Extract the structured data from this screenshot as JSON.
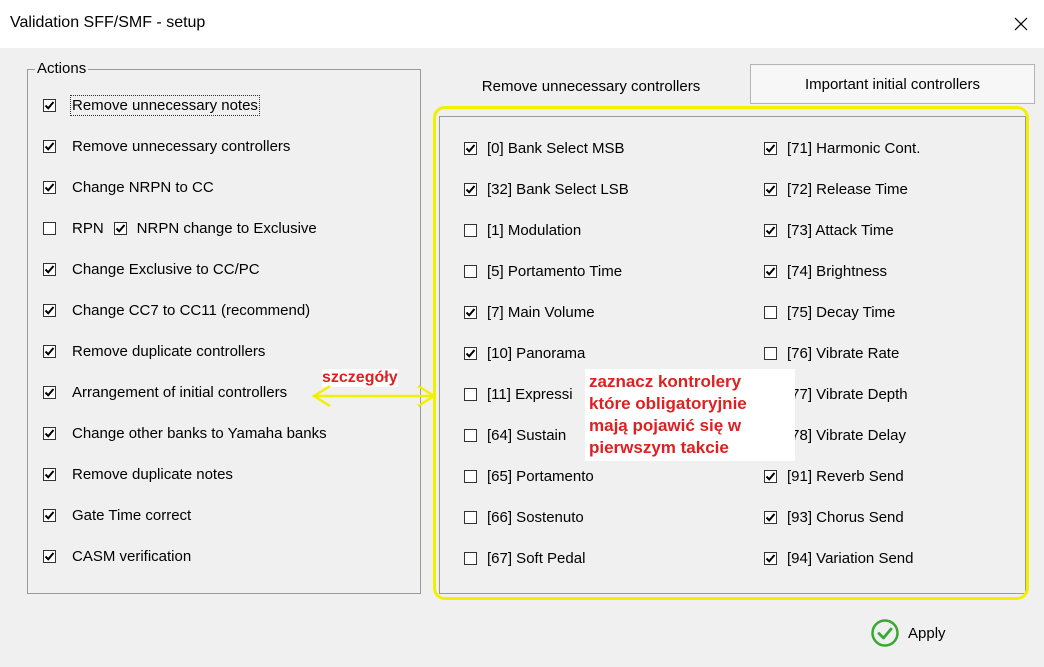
{
  "window": {
    "title": "Validation SFF/SMF - setup",
    "close_glyph": "×"
  },
  "actions": {
    "legend": "Actions",
    "items": [
      {
        "label": "Remove unnecessary notes",
        "checked": true
      },
      {
        "label": "Remove unnecessary controllers",
        "checked": true
      },
      {
        "label": "Change NRPN to CC",
        "checked": true
      },
      {
        "label": "RPN",
        "checked": false,
        "second_label": "NRPN  change to Exclusive",
        "second_checked": true
      },
      {
        "label": "Change Exclusive to CC/PC",
        "checked": true
      },
      {
        "label": "Change CC7 to CC11 (recommend)",
        "checked": true
      },
      {
        "label": "Remove duplicate controllers",
        "checked": true
      },
      {
        "label": "Arrangement of initial controllers",
        "checked": true
      },
      {
        "label": "Change other banks to Yamaha banks",
        "checked": true
      },
      {
        "label": "Remove duplicate notes",
        "checked": true
      },
      {
        "label": "Gate Time correct",
        "checked": true
      },
      {
        "label": "CASM verification",
        "checked": true
      }
    ]
  },
  "tabs": [
    {
      "label": "Remove unnecessary controllers",
      "active": true
    },
    {
      "label": "Important initial controllers",
      "active": false
    }
  ],
  "controllers": {
    "left": [
      {
        "label": "[0] Bank Select MSB",
        "checked": true
      },
      {
        "label": "[32] Bank Select LSB",
        "checked": true
      },
      {
        "label": "[1] Modulation",
        "checked": false
      },
      {
        "label": "[5] Portamento Time",
        "checked": false
      },
      {
        "label": "[7] Main Volume",
        "checked": true
      },
      {
        "label": "[10] Panorama",
        "checked": true
      },
      {
        "label": "[11] Expressi",
        "checked": false
      },
      {
        "label": "[64] Sustain",
        "checked": false
      },
      {
        "label": "[65] Portamento",
        "checked": false
      },
      {
        "label": "[66] Sostenuto",
        "checked": false
      },
      {
        "label": "[67] Soft Pedal",
        "checked": false
      }
    ],
    "right": [
      {
        "label": "[71] Harmonic Cont.",
        "checked": true
      },
      {
        "label": "[72] Release Time",
        "checked": true
      },
      {
        "label": "[73] Attack Time",
        "checked": true
      },
      {
        "label": "[74] Brightness",
        "checked": true
      },
      {
        "label": "[75] Decay Time",
        "checked": false
      },
      {
        "label": "[76] Vibrate Rate",
        "checked": false
      },
      {
        "label": "[77] Vibrate Depth",
        "checked": false
      },
      {
        "label": "[78] Vibrate Delay",
        "checked": false
      },
      {
        "label": "[91] Reverb Send",
        "checked": true
      },
      {
        "label": "[93] Chorus Send",
        "checked": true
      },
      {
        "label": "[94] Variation Send",
        "checked": true
      }
    ]
  },
  "annotations": {
    "details": "szczegóły",
    "note_lines": [
      "zaznacz kontrolery",
      "które obligatoryjnie",
      "mają pojawić się w",
      "pierwszym takcie"
    ]
  },
  "apply": {
    "label": "Apply"
  },
  "colors": {
    "highlight": "#f0f000",
    "annotation_text": "#e02020",
    "apply_icon": "#3aa832"
  }
}
